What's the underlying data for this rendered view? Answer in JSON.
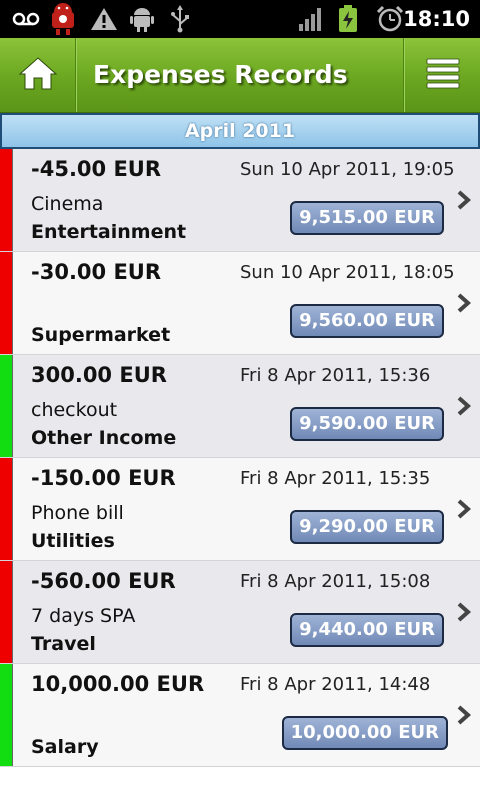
{
  "status_bar": {
    "time": "18:10",
    "icons": [
      "voicemail-icon",
      "android-alert-icon",
      "warning-icon",
      "android-debug-icon",
      "usb-icon",
      "signal-icon",
      "battery-charging-icon",
      "alarm-icon"
    ]
  },
  "action_bar": {
    "title": "Expenses Records",
    "home_icon": "home-icon",
    "menu_icon": "menu-icon"
  },
  "month_header": "April 2011",
  "colors": {
    "negative": "#ee0000",
    "positive": "#11dd11",
    "actionbar": "#6aa620",
    "balance_badge": "#7f97c4"
  },
  "records": [
    {
      "amount": "-45.00 EUR",
      "date": "Sun 10 Apr 2011, 19:05",
      "note": "Cinema",
      "category": "Entertainment",
      "balance": "9,515.00 EUR",
      "type": "neg"
    },
    {
      "amount": "-30.00 EUR",
      "date": "Sun 10 Apr 2011, 18:05",
      "note": "",
      "category": "Supermarket",
      "balance": "9,560.00 EUR",
      "type": "neg"
    },
    {
      "amount": "300.00 EUR",
      "date": "Fri 8 Apr 2011, 15:36",
      "note": "checkout",
      "category": "Other Income",
      "balance": "9,590.00 EUR",
      "type": "pos"
    },
    {
      "amount": "-150.00 EUR",
      "date": "Fri 8 Apr 2011, 15:35",
      "note": "Phone bill",
      "category": "Utilities",
      "balance": "9,290.00 EUR",
      "type": "neg"
    },
    {
      "amount": "-560.00 EUR",
      "date": "Fri 8 Apr 2011, 15:08",
      "note": "7 days SPA",
      "category": "Travel",
      "balance": "9,440.00 EUR",
      "type": "neg"
    },
    {
      "amount": "10,000.00 EUR",
      "date": "Fri 8 Apr 2011, 14:48",
      "note": "",
      "category": "Salary",
      "balance": "10,000.00 EUR",
      "type": "pos"
    }
  ]
}
